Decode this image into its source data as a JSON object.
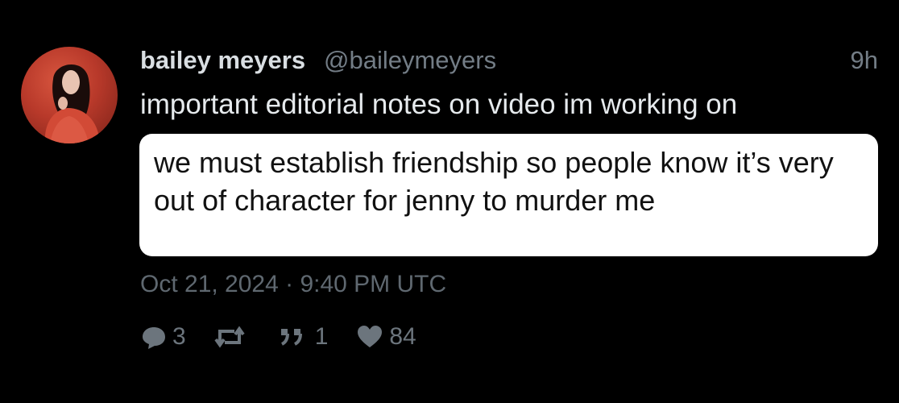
{
  "tweet": {
    "author_name": "bailey meyers",
    "author_handle": "@baileymeyers",
    "relative_time": "9h",
    "text": "important editorial notes on video im working on",
    "attached_note": "we must establish friendship so people know it’s very out of character for jenny to murder me",
    "timestamp": "Oct 21, 2024 · 9:40 PM UTC",
    "stats": {
      "replies": "3",
      "retweets": "",
      "quotes": "1",
      "likes": "84"
    }
  },
  "icons": {
    "reply": "reply-bubble-icon",
    "retweet": "retweet-icon",
    "quote": "quote-icon",
    "like": "heart-icon"
  },
  "colors": {
    "background": "#000000",
    "name": "#d9dee2",
    "muted": "#737d86",
    "note_bg": "#ffffff",
    "avatar_red": "#c0412f"
  }
}
